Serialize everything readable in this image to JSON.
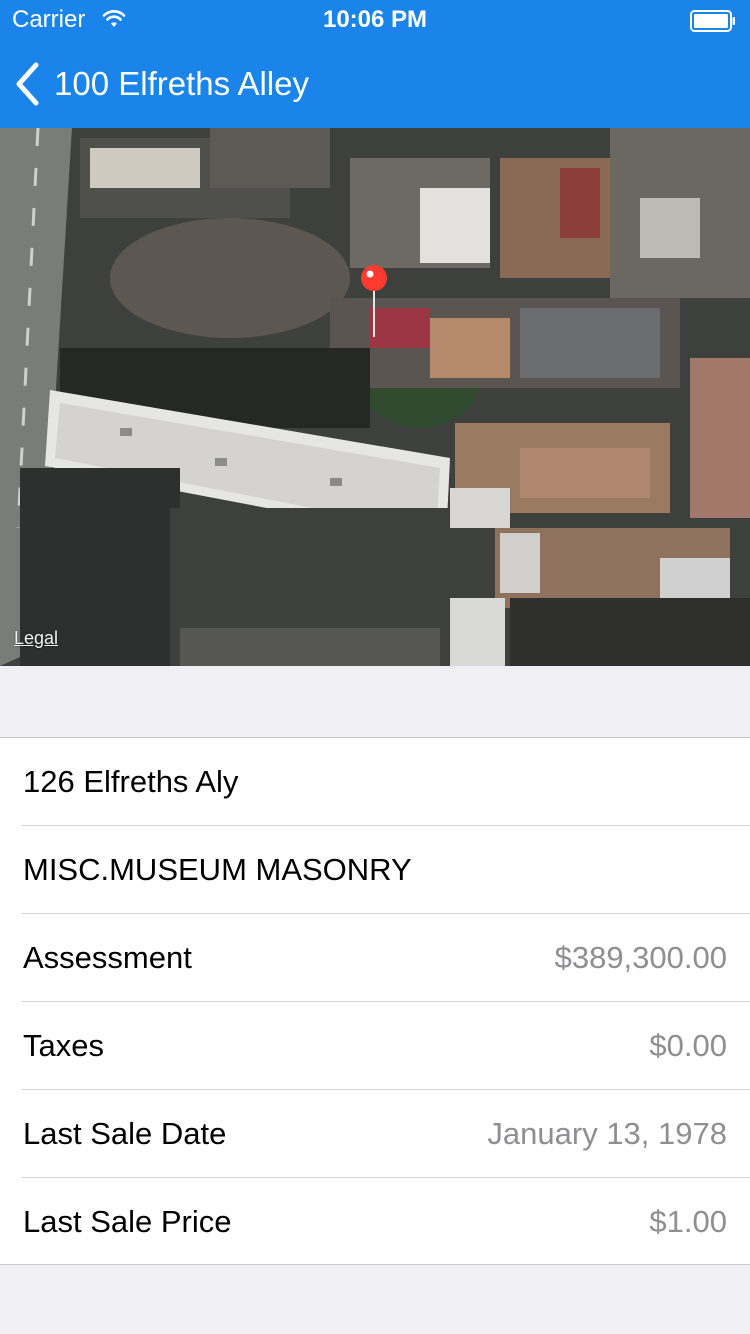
{
  "status_bar": {
    "carrier": "Carrier",
    "time": "10:06 PM"
  },
  "nav": {
    "back_icon": "chevron-left-icon",
    "title": "100 Elfreths Alley"
  },
  "map": {
    "legal_label": "Legal",
    "pin_color": "#ff3b30"
  },
  "details": {
    "address": "126 Elfreths Aly",
    "category": "MISC.MUSEUM MASONRY",
    "rows": [
      {
        "label": "Assessment",
        "value": "$389,300.00"
      },
      {
        "label": "Taxes",
        "value": "$0.00"
      },
      {
        "label": "Last Sale Date",
        "value": "January 13, 1978"
      },
      {
        "label": "Last Sale Price",
        "value": "$1.00"
      }
    ]
  },
  "colors": {
    "accent": "#1b84ea",
    "background": "#efeff4",
    "secondary_text": "#8e8e93"
  }
}
